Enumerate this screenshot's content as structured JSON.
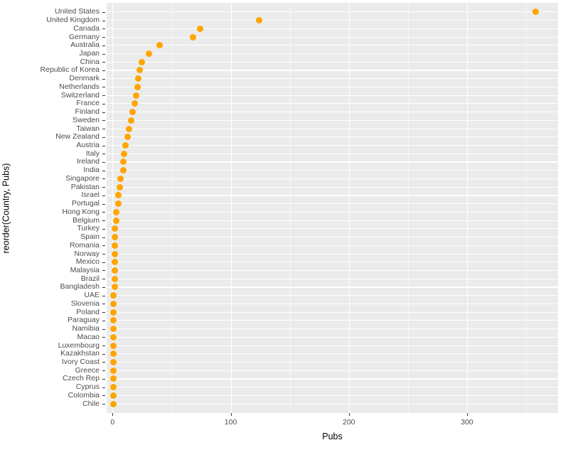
{
  "chart_data": {
    "type": "scatter",
    "title": "",
    "subtitle": "",
    "xlabel": "Pubs",
    "ylabel": "reorder(Country, Pubs)",
    "xlim": [
      -5,
      377
    ],
    "ylim_categories": 47,
    "grid": true,
    "legend": "none",
    "point_color": "#FFA500",
    "panel_background": "#EBEBEB",
    "gridline_color": "#FFFFFF",
    "x_ticks": [
      0,
      100,
      200,
      300
    ],
    "x_tick_labels": [
      "0",
      "100",
      "200",
      "300"
    ],
    "x_minor_ticks": [
      50,
      150,
      250,
      350
    ],
    "categories": [
      "United States",
      "United Kingdom",
      "Canada",
      "Germany",
      "Australia",
      "Japan",
      "China",
      "Republic of Korea",
      "Denmark",
      "Netherlands",
      "Switzerland",
      "France",
      "Finland",
      "Sweden",
      "Taiwan",
      "New Zealand",
      "Austria",
      "Italy",
      "Ireland",
      "India",
      "Singapore",
      "Pakistan",
      "Israel",
      "Portugal",
      "Hong Kong",
      "Belgium",
      "Turkey",
      "Spain",
      "Romania",
      "Norway",
      "Mexico",
      "Malaysia",
      "Brazil",
      "Bangladesh",
      "UAE",
      "Slovenia",
      "Poland",
      "Paraguay",
      "Namibia",
      "Macao",
      "Luxembourg",
      "Kazakhstan",
      "Ivory Coast",
      "Greece",
      "Czech Rep",
      "Cyprus",
      "Colombia",
      "Chile"
    ],
    "values": [
      358,
      124,
      74,
      68,
      40,
      31,
      25,
      23,
      22,
      21,
      20,
      19,
      17,
      16,
      14,
      13,
      11,
      10,
      9,
      9,
      7,
      6,
      5,
      5,
      3,
      3,
      2,
      2,
      2,
      2,
      2,
      2,
      2,
      2,
      1,
      1,
      1,
      1,
      1,
      1,
      1,
      1,
      1,
      1,
      1,
      1,
      1,
      1
    ]
  }
}
